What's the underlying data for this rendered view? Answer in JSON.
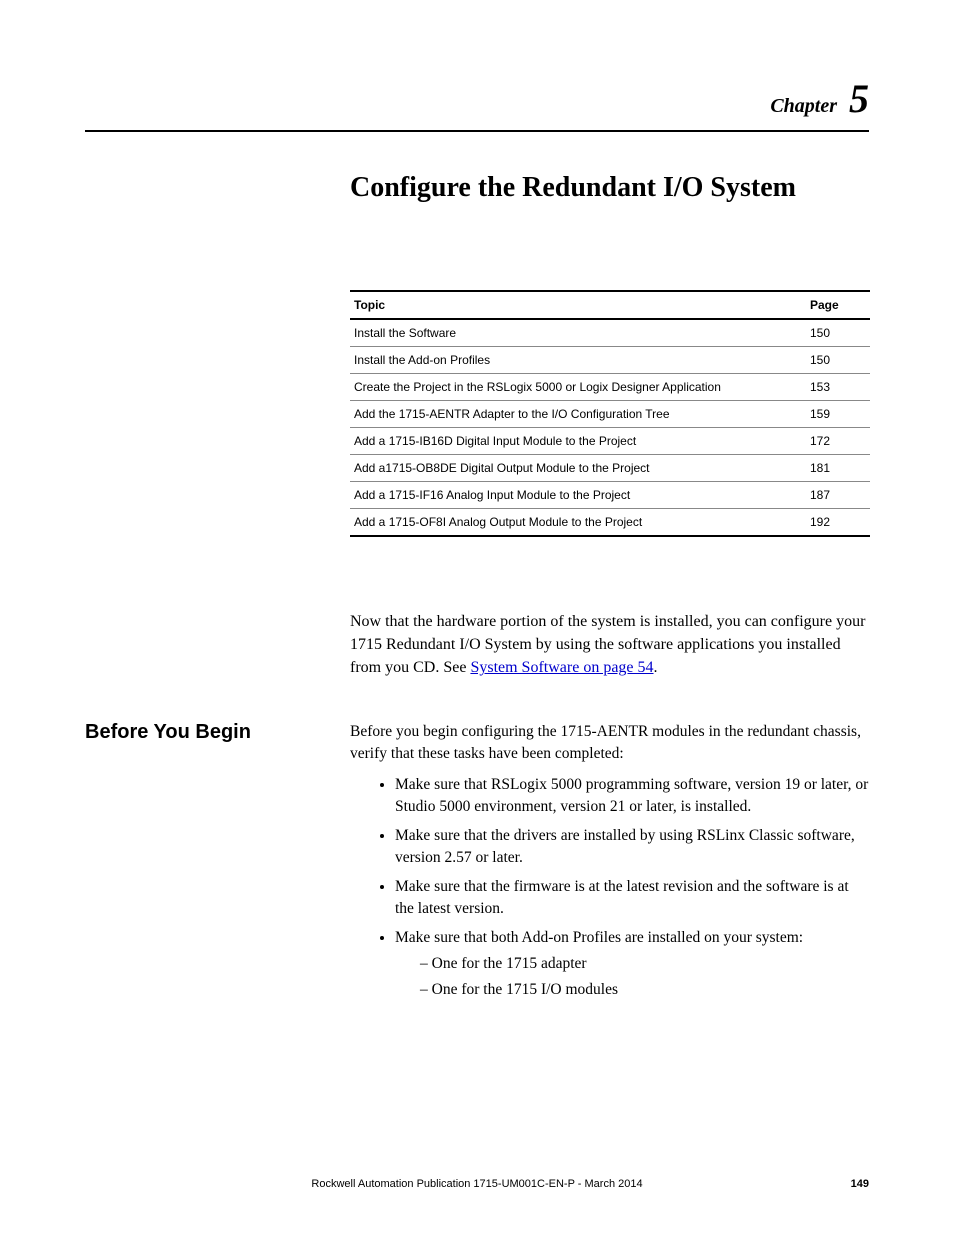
{
  "header": {
    "chapter_label": "Chapter",
    "chapter_number": "5"
  },
  "title": "Configure the Redundant I/O System",
  "toc": {
    "col_topic": "Topic",
    "col_page": "Page",
    "rows": [
      {
        "topic": "Install the Software",
        "page": "150"
      },
      {
        "topic": "Install the Add-on Profiles",
        "page": "150"
      },
      {
        "topic": "Create the Project in the RSLogix 5000 or Logix Designer Application",
        "page": "153"
      },
      {
        "topic": "Add the 1715-AENTR Adapter to the I/O Configuration Tree",
        "page": "159"
      },
      {
        "topic": "Add a 1715-IB16D Digital Input Module to the Project",
        "page": "172"
      },
      {
        "topic": "Add a1715-OB8DE Digital Output Module to the Project",
        "page": "181"
      },
      {
        "topic": "Add a 1715-IF16 Analog Input Module to the Project",
        "page": "187"
      },
      {
        "topic": "Add a 1715-OF8I Analog Output Module to the Project",
        "page": "192"
      }
    ]
  },
  "intro": {
    "before_link": "Now that the hardware portion of the system is installed, you can configure your 1715 Redundant I/O System by using the software applications you installed from you CD. See ",
    "link_text": "System Software on page 54",
    "after_link": "."
  },
  "section": {
    "heading": "Before You Begin",
    "lead": "Before you begin configuring the 1715-AENTR modules in the redundant chassis, verify that these tasks have been completed:",
    "bullets": [
      "Make sure that RSLogix 5000 programming software, version 19 or later, or Studio 5000 environment, version 21 or later, is installed.",
      "Make sure that the drivers are installed by using RSLinx Classic software, version 2.57 or later.",
      "Make sure that the firmware is at the latest revision and the software is at the latest version."
    ],
    "bullet_with_subs": "Make sure that both Add-on Profiles are installed on your system:",
    "subs": [
      "One for the 1715 adapter",
      "One for the 1715 I/O modules"
    ]
  },
  "footer": {
    "publication": "Rockwell Automation Publication 1715-UM001C-EN-P - March 2014",
    "page_no": "149"
  }
}
